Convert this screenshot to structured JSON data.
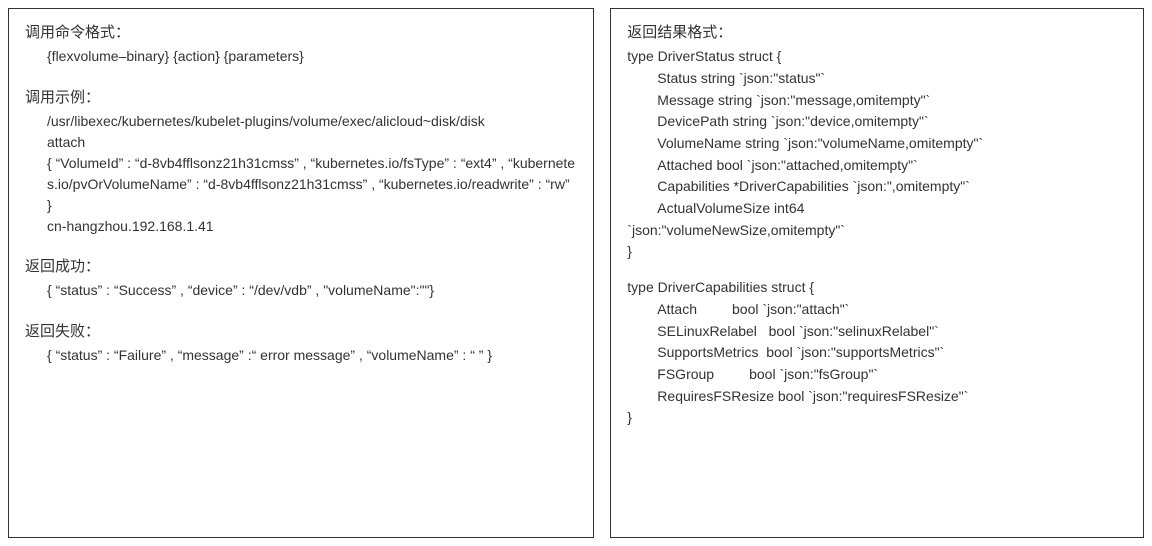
{
  "left": {
    "sec1_title": "调用命令格式：",
    "sec1_line1": "{flexvolume–binary} {action} {parameters}",
    "sec2_title": "调用示例：",
    "sec2_line1": "/usr/libexec/kubernetes/kubelet-plugins/volume/exec/alicloud~disk/disk",
    "sec2_line2": "attach",
    "sec2_line3": "{ “VolumeId” : “d-8vb4fflsonz21h31cmss” , “kubernetes.io/fsType” : “ext4” , “kubernetes.io/pvOrVolumeName” : “d-8vb4fflsonz21h31cmss” , “kubernetes.io/readwrite” : “rw” }",
    "sec2_line4": "cn-hangzhou.192.168.1.41",
    "sec3_title": "返回成功：",
    "sec3_line1": "{ “status” : “Success” ,   “device” : “/dev/vdb” ,  \"volumeName\":\"\"}",
    "sec4_title": "返回失败：",
    "sec4_line1": "{ “status” : “Failure” ,   “message” :“ error message” ,   “volumeName” : “ ” }"
  },
  "right": {
    "title": "返回结果格式：",
    "s1_open": "type DriverStatus struct {",
    "s1_f1": "Status string `json:\"status\"`",
    "s1_f2": "Message string `json:\"message,omitempty\"`",
    "s1_f3": "DevicePath string `json:\"device,omitempty\"`",
    "s1_f4": "VolumeName string `json:\"volumeName,omitempty\"`",
    "s1_f5": "Attached bool `json:\"attached,omitempty\"`",
    "s1_f6": "Capabilities *DriverCapabilities `json:\",omitempty\"`",
    "s1_f7a": "ActualVolumeSize int64",
    "s1_f7b": "`json:\"volumeNewSize,omitempty\"`",
    "s1_close": "}",
    "s2_open": "type DriverCapabilities struct {",
    "s2_f1": "Attach         bool `json:\"attach\"`",
    "s2_f2": "SELinuxRelabel   bool `json:\"selinuxRelabel\"`",
    "s2_f3": "SupportsMetrics  bool `json:\"supportsMetrics\"`",
    "s2_f4": "FSGroup         bool `json:\"fsGroup\"`",
    "s2_f5": "RequiresFSResize bool `json:\"requiresFSResize\"`",
    "s2_close": "}"
  }
}
